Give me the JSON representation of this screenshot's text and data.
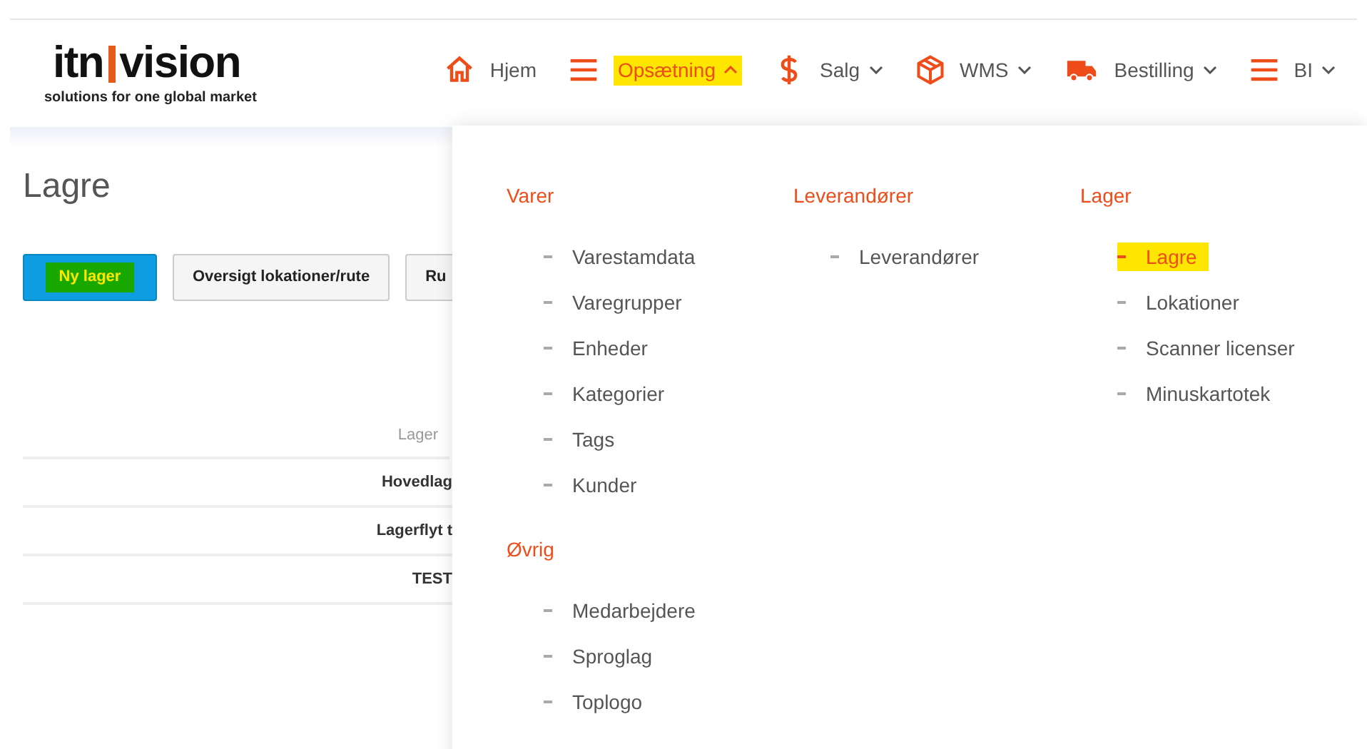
{
  "logo": {
    "brand_left": "itn",
    "brand_right": "vision",
    "tagline": "solutions for one global market"
  },
  "nav": [
    {
      "label": "Hjem",
      "kind": "home",
      "selected": false
    },
    {
      "label": "Opsætning",
      "kind": "menu",
      "expanded": true,
      "selected": true
    },
    {
      "label": "Salg",
      "kind": "dollar",
      "expanded": false,
      "selected": false
    },
    {
      "label": "WMS",
      "kind": "box",
      "expanded": false,
      "selected": false
    },
    {
      "label": "Bestilling",
      "kind": "truck",
      "expanded": false,
      "selected": false
    },
    {
      "label": "BI",
      "kind": "menu",
      "expanded": false,
      "selected": false
    }
  ],
  "page_title": "Lagre",
  "buttons": [
    {
      "label": "Ny lager",
      "kind": "primary"
    },
    {
      "label": "Oversigt lokationer/rute",
      "kind": "default"
    },
    {
      "label": "Ru",
      "kind": "default"
    }
  ],
  "table": {
    "columns": [
      "Lager"
    ],
    "rows": [
      [
        "Hovedlag"
      ],
      [
        "Lagerflyt t"
      ],
      [
        "TEST"
      ]
    ]
  },
  "menu": [
    {
      "sections": [
        {
          "heading": "Varer",
          "items": [
            {
              "label": "Varestamdata",
              "selected": false
            },
            {
              "label": "Varegrupper",
              "selected": false
            },
            {
              "label": "Enheder",
              "selected": false
            },
            {
              "label": "Kategorier",
              "selected": false
            },
            {
              "label": "Tags",
              "selected": false
            },
            {
              "label": "Kunder",
              "selected": false
            }
          ]
        },
        {
          "heading": "Øvrig",
          "items": [
            {
              "label": "Medarbejdere",
              "selected": false
            },
            {
              "label": "Sproglag",
              "selected": false
            },
            {
              "label": "Toplogo",
              "selected": false
            }
          ]
        }
      ]
    },
    {
      "sections": [
        {
          "heading": "Leverandører",
          "items": [
            {
              "label": "Leverandører",
              "selected": false
            }
          ]
        }
      ]
    },
    {
      "sections": [
        {
          "heading": "Lager",
          "items": [
            {
              "label": "Lagre",
              "selected": true
            },
            {
              "label": "Lokationer",
              "selected": false
            },
            {
              "label": "Scanner licenser",
              "selected": false
            },
            {
              "label": "Minuskartotek",
              "selected": false
            }
          ]
        }
      ]
    }
  ]
}
